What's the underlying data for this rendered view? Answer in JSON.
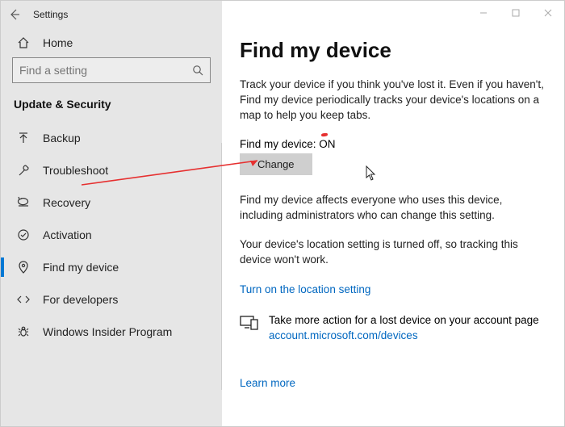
{
  "title": "Settings",
  "home_label": "Home",
  "search_placeholder": "Find a setting",
  "category": "Update & Security",
  "nav": [
    {
      "label": "Backup"
    },
    {
      "label": "Troubleshoot"
    },
    {
      "label": "Recovery"
    },
    {
      "label": "Activation"
    },
    {
      "label": "Find my device"
    },
    {
      "label": "For developers"
    },
    {
      "label": "Windows Insider Program"
    }
  ],
  "main": {
    "heading": "Find my device",
    "desc": "Track your device if you think you've lost it. Even if you haven't, Find my device periodically tracks your device's locations on a map to help you keep tabs.",
    "status": "Find my device: ON",
    "change": "Change",
    "body1": "Find my device affects everyone who uses this device, including administrators who can change this setting.",
    "body2": "Your device's location setting is turned off, so tracking this device won't work.",
    "turn_on": "Turn on the location setting",
    "action_text": "Take more action for a lost device on your account page",
    "action_link": "account.microsoft.com/devices",
    "learn": "Learn more"
  }
}
